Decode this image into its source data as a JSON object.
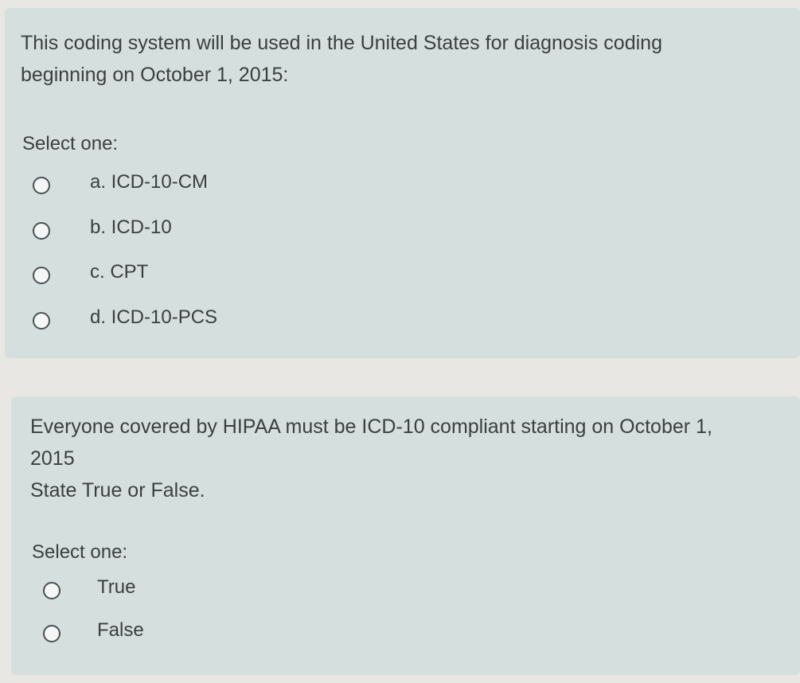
{
  "questions": [
    {
      "text_lines": [
        "This coding system will be used in the United States for diagnosis coding",
        "beginning on October 1, 2015:"
      ],
      "prompt": "Select one:",
      "options": [
        "a. ICD-10-CM",
        "b. ICD-10",
        "c. CPT",
        "d. ICD-10-PCS"
      ]
    },
    {
      "text_lines": [
        "Everyone covered by HIPAA must be ICD-10 compliant starting on October 1,",
        "2015",
        "State True or False."
      ],
      "prompt": "Select one:",
      "options": [
        "True",
        "False"
      ]
    }
  ],
  "colors": {
    "card_background": "#d5dfde",
    "page_background": "#e9e7e4",
    "text": "#3b3f40"
  },
  "icons": {
    "option_marker": "radio-button-unselected-icon"
  }
}
